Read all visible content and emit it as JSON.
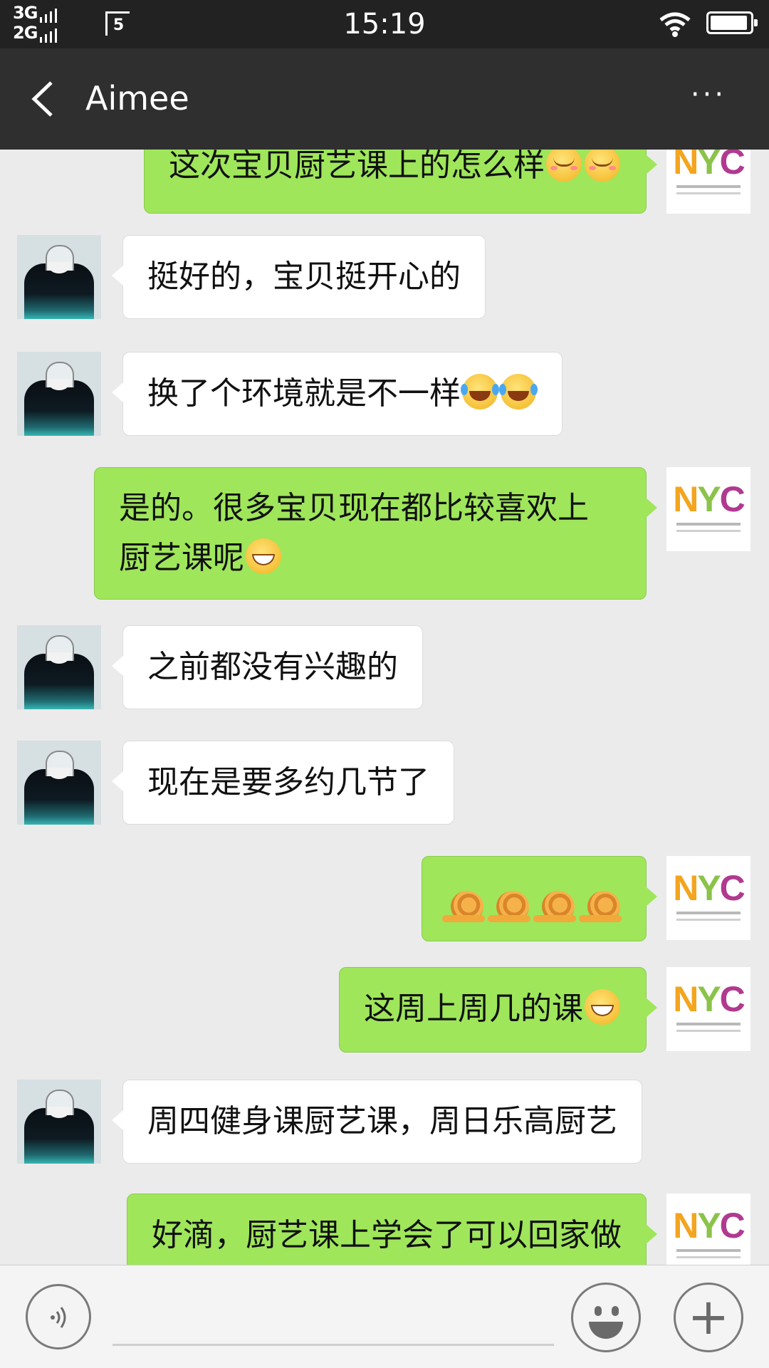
{
  "status_bar": {
    "network_top": "3G",
    "network_bottom": "2G",
    "time": "15:19",
    "icons": [
      "signal-icon",
      "sim-icon",
      "wifi-icon",
      "battery-icon"
    ],
    "battery_level": 0.95
  },
  "header": {
    "title": "Aimee",
    "back_icon": "chevron-left-icon",
    "more_icon": "more-dots-icon",
    "more_label": "···"
  },
  "my_avatar": {
    "logo_n": "N",
    "logo_y": "Y",
    "logo_c": "C"
  },
  "messages": [
    {
      "sender": "me",
      "text": "这次宝贝厨艺课上的怎么样",
      "emoji": [
        "smile",
        "smile"
      ]
    },
    {
      "sender": "other",
      "text": "挺好的，宝贝挺开心的",
      "emoji": []
    },
    {
      "sender": "other",
      "text": "换了个环境就是不一样",
      "emoji": [
        "laugh",
        "laugh"
      ]
    },
    {
      "sender": "me",
      "text_line1": "是的。很多宝贝现在都比较喜欢上",
      "text_line2": "厨艺课呢",
      "emoji": [
        "grin"
      ]
    },
    {
      "sender": "other",
      "text": "之前都没有兴趣的",
      "emoji": []
    },
    {
      "sender": "other",
      "text": "现在是要多约几节了",
      "emoji": []
    },
    {
      "sender": "me",
      "text": "",
      "emoji": [
        "snail",
        "snail",
        "snail",
        "snail"
      ]
    },
    {
      "sender": "me",
      "text": "这周上周几的课",
      "emoji": [
        "grin"
      ]
    },
    {
      "sender": "other",
      "text": "周四健身课厨艺课，周日乐高厨艺",
      "emoji": []
    },
    {
      "sender": "me",
      "text": "好滴，厨艺课上学会了可以回家做",
      "emoji": []
    }
  ],
  "input_bar": {
    "voice_icon": "voice-icon",
    "emoji_icon": "emoji-face-icon",
    "plus_icon": "plus-icon",
    "plus_label": "+"
  }
}
